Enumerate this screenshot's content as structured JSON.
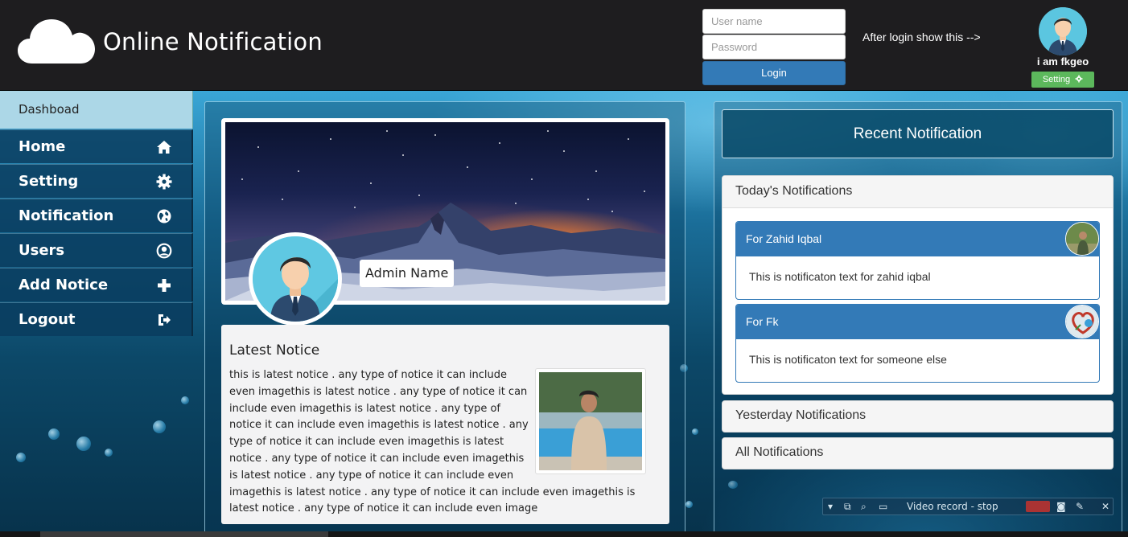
{
  "header": {
    "site_title": "Online Notification",
    "username_placeholder": "User name",
    "password_placeholder": "Password",
    "login_label": "Login",
    "after_login_note": "After login show this -->",
    "user_name": "i am fkgeo",
    "setting_label": "Setting"
  },
  "sidebar": {
    "dashboard_label": "Dashboad",
    "items": [
      {
        "label": "Home",
        "icon": "home-icon"
      },
      {
        "label": "Setting",
        "icon": "gear-icon"
      },
      {
        "label": "Notification",
        "icon": "globe-icon"
      },
      {
        "label": "Users",
        "icon": "user-circle-icon"
      },
      {
        "label": "Add Notice",
        "icon": "plus-icon"
      },
      {
        "label": "Logout",
        "icon": "logout-icon"
      }
    ]
  },
  "profile": {
    "admin_name": "Admin Name"
  },
  "latest_notice": {
    "title": "Latest Notice",
    "text": "this is latest notice . any type of notice it can include even imagethis is latest notice . any type of notice it can include even imagethis is latest notice . any type of notice it can include even imagethis is latest notice . any type of notice it can include even imagethis is latest notice . any type of notice it can include even imagethis is latest notice . any type of notice it can include even imagethis is latest notice . any type of notice it can include even imagethis is latest notice . any type of notice it can include even image"
  },
  "notifications": {
    "recent_title": "Recent Notification",
    "today_title": "Today's Notifications",
    "items": [
      {
        "heading": "For Zahid Iqbal",
        "body": "This is notificaton text for zahid iqbal"
      },
      {
        "heading": "For Fk",
        "body": "This is notificaton text for someone else"
      }
    ],
    "yesterday_title": "Yesterday Notifications",
    "all_title": "All Notifications"
  },
  "recorder": {
    "label": "Video record - stop"
  },
  "colors": {
    "header_bg": "#1e1d1f",
    "primary": "#337ab7",
    "success": "#5cb85c",
    "dashboard_bg": "#acd7e7"
  }
}
